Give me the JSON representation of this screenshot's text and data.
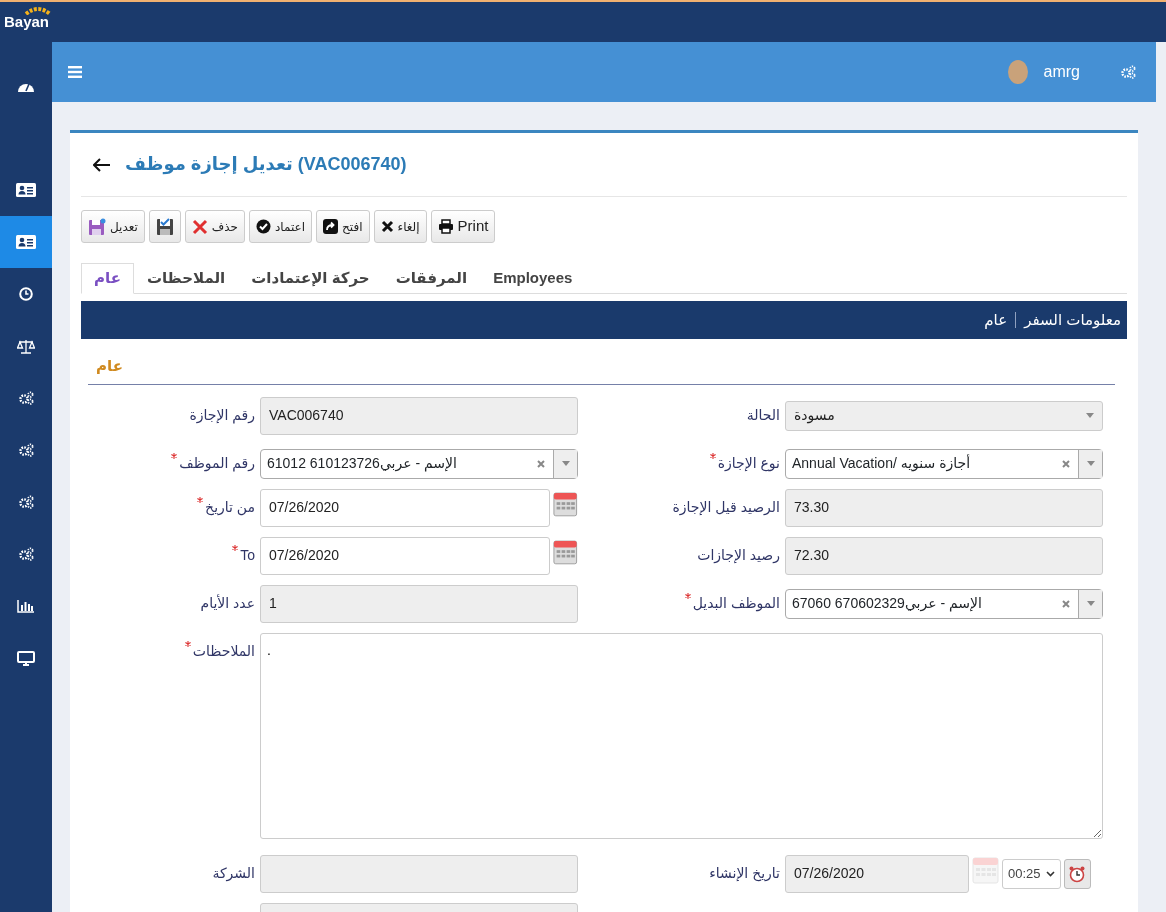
{
  "app": {
    "logo": "Bayan"
  },
  "sidebar": {
    "items": [
      {
        "kind": "dashboard",
        "selected": false
      },
      {
        "kind": "id-card",
        "selected": false
      },
      {
        "kind": "id-card",
        "selected": true
      },
      {
        "kind": "clock",
        "selected": false
      },
      {
        "kind": "scale",
        "selected": false
      },
      {
        "kind": "gears",
        "selected": false
      },
      {
        "kind": "gears",
        "selected": false
      },
      {
        "kind": "gears",
        "selected": false
      },
      {
        "kind": "gears",
        "selected": false
      },
      {
        "kind": "chart",
        "selected": false
      },
      {
        "kind": "monitor",
        "selected": false
      }
    ]
  },
  "header": {
    "user": "amrg"
  },
  "page": {
    "title": "تعديل إجازة موظف (VAC006740)"
  },
  "toolbar": [
    {
      "kind": "print",
      "label": "Print"
    },
    {
      "kind": "cancel",
      "label": "إلغاء"
    },
    {
      "kind": "open",
      "label": "افتح"
    },
    {
      "kind": "approve",
      "label": "اعتماد"
    },
    {
      "kind": "delete",
      "label": "حذف"
    },
    {
      "kind": "save"
    },
    {
      "kind": "edit",
      "label": "تعديل"
    }
  ],
  "tabs": [
    {
      "label": "Employees",
      "selected": false
    },
    {
      "label": "المرفقات",
      "selected": false
    },
    {
      "label": "حركة الإعتمادات",
      "selected": false
    },
    {
      "label": "الملاحظات",
      "selected": false
    },
    {
      "label": "عام",
      "selected": true
    }
  ],
  "section_bar": {
    "items": [
      "معلومات السفر",
      "عام"
    ]
  },
  "section_title": "عام",
  "form_rows": [
    {
      "left": {
        "label": "رقم الإجازة",
        "kind": "readonly",
        "value": "VAC006740",
        "required": false
      },
      "right": {
        "label": "الحالة",
        "kind": "select",
        "value": "مسودة",
        "required": false
      }
    },
    {
      "left": {
        "label": "رقم الموظف",
        "kind": "combo",
        "value": "61012 610123726الإسم - عربي",
        "required": true
      },
      "right": {
        "label": "نوع الإجازة",
        "kind": "combo",
        "value": "Annual Vacation/ أجازة سنويه",
        "required": true
      }
    },
    {
      "left": {
        "label": "من تاريخ",
        "kind": "date",
        "value": "07/26/2020",
        "required": true
      },
      "right": {
        "label": "الرصيد قيل الإجازة",
        "kind": "readonly",
        "value": "73.30",
        "required": false
      }
    },
    {
      "left": {
        "label": "To",
        "kind": "date",
        "value": "07/26/2020",
        "required": true
      },
      "right": {
        "label": "رصيد الإجازات",
        "kind": "readonly",
        "value": "72.30",
        "required": false
      }
    },
    {
      "left": {
        "label": "عدد الأيام",
        "kind": "readonly",
        "value": "1",
        "required": false
      },
      "right": {
        "label": "الموظف البديل",
        "kind": "combo",
        "value": "67060 670602329الإسم - عربي",
        "required": true
      }
    },
    {
      "full": {
        "label": "الملاحظات",
        "kind": "textarea",
        "value": ".",
        "required": true
      }
    },
    {
      "left": {
        "label": "الشركة",
        "kind": "readonly",
        "required": false
      },
      "right": {
        "label": "تاريخ الإنشاء",
        "kind": "datetime",
        "value": "07/26/2020",
        "time": "00:25",
        "required": false
      }
    },
    {
      "left": {
        "kind": "readonly"
      }
    }
  ]
}
